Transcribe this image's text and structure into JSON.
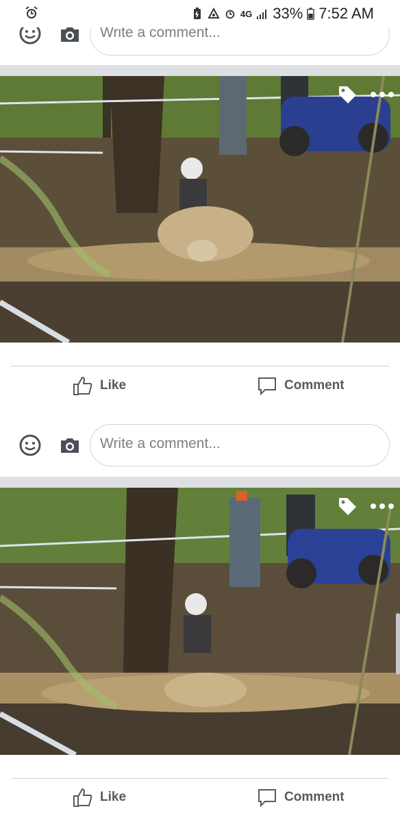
{
  "status_bar": {
    "battery_percent": "33%",
    "network": "4G",
    "time": "7:52 AM"
  },
  "comment_box": {
    "placeholder": "Write a comment..."
  },
  "post_actions": {
    "like_label": "Like",
    "comment_label": "Comment"
  },
  "colors": {
    "icon_blue": "#4b4f56",
    "text_gray": "#555960",
    "divider": "#cfd1d5",
    "background": "#dddfe2"
  },
  "icons": [
    "alarm-icon",
    "battery-saver-icon",
    "recycle-icon",
    "alarm-icon",
    "signal-icon",
    "battery-icon",
    "emoji-icon",
    "camera-icon",
    "tag-icon",
    "more-icon",
    "like-icon",
    "comment-icon"
  ]
}
